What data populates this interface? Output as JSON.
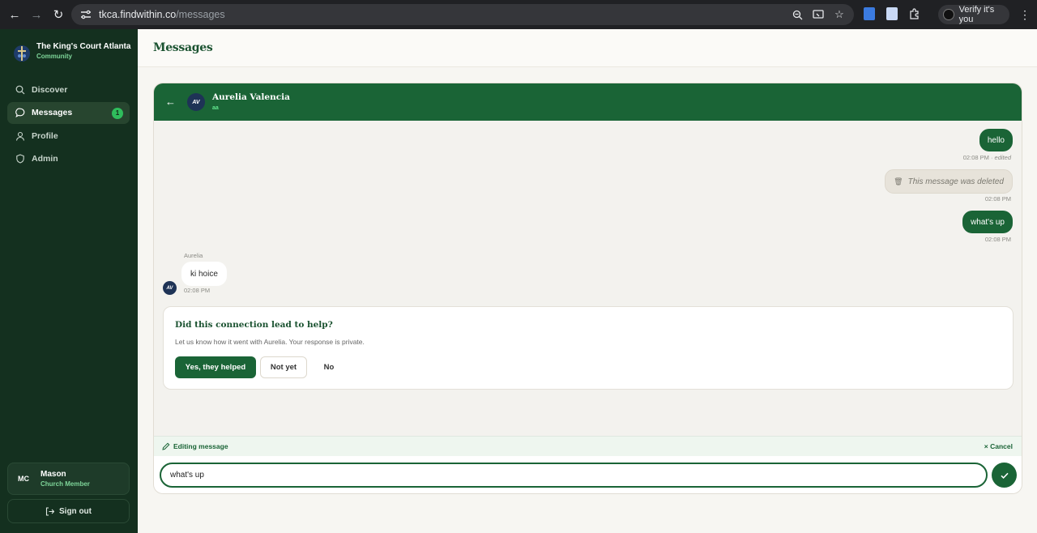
{
  "browser": {
    "url_host": "tkca.findwithin.co",
    "url_path": "/messages",
    "profile_label": "Verify it's you"
  },
  "sidebar": {
    "brand_name": "The King's Court Atlanta",
    "brand_sub": "Community",
    "nav": [
      {
        "label": "Discover",
        "icon": "search-icon"
      },
      {
        "label": "Messages",
        "icon": "chat-bubble-icon",
        "badge": "1",
        "active": true
      },
      {
        "label": "Profile",
        "icon": "user-icon"
      },
      {
        "label": "Admin",
        "icon": "shield-icon"
      }
    ],
    "user": {
      "initials": "MC",
      "name": "Mason",
      "role": "Church Member"
    },
    "signout_label": "Sign out"
  },
  "page": {
    "title": "Messages"
  },
  "chat": {
    "contact": {
      "initials": "AV",
      "name": "Aurelia Valencia",
      "status": "aa"
    },
    "messages": {
      "m1": {
        "text": "hello",
        "time": "02:08 PM",
        "edited": "· edited"
      },
      "m2": {
        "text": "This message was deleted",
        "time": "02:08 PM"
      },
      "m3": {
        "text": "what's up",
        "time": "02:08 PM"
      },
      "m4": {
        "sender": "Aurelia",
        "text": "ki hoice",
        "time": "02:08 PM"
      }
    },
    "feedback": {
      "title": "Did this connection lead to help?",
      "subtitle": "Let us know how it went with Aurelia. Your response is private.",
      "yes": "Yes, they helped",
      "not_yet": "Not yet",
      "no": "No"
    },
    "editing": {
      "label": "Editing message",
      "cancel": "× Cancel"
    },
    "composer": {
      "value": "what's up"
    }
  },
  "colors": {
    "brand_green": "#1a6436",
    "sidebar_bg": "#14301f",
    "accent_badge": "#2fbd5c"
  }
}
